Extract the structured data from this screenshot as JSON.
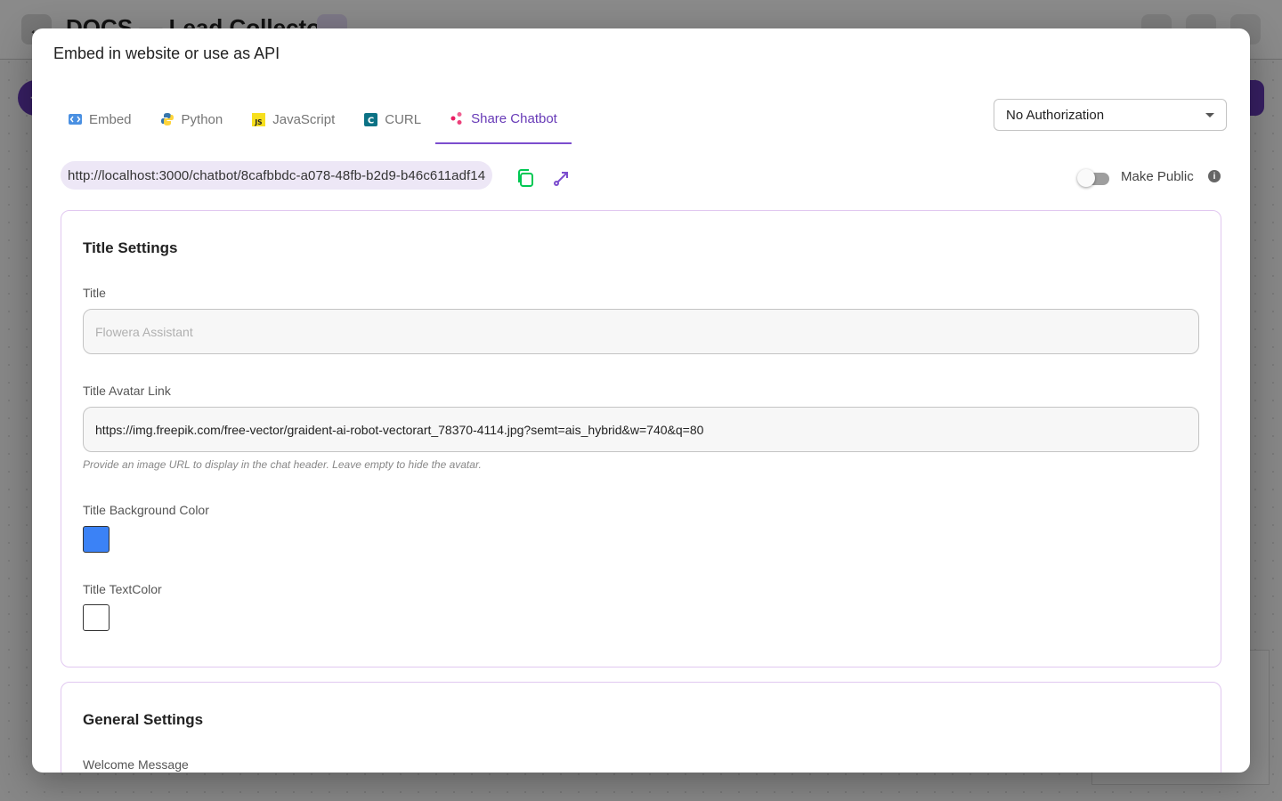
{
  "background": {
    "page_title": "DOCS — Lead Collector",
    "back_icon": "arrow-left-icon",
    "add_icon": "plus-icon"
  },
  "modal": {
    "title": "Embed in website or use as API",
    "tabs": [
      {
        "label": "Embed",
        "icon": "code-icon",
        "active": false
      },
      {
        "label": "Python",
        "icon": "python-icon",
        "active": false
      },
      {
        "label": "JavaScript",
        "icon": "javascript-icon",
        "active": false
      },
      {
        "label": "CURL",
        "icon": "curl-icon",
        "active": false
      },
      {
        "label": "Share Chatbot",
        "icon": "share-icon",
        "active": true
      }
    ],
    "authorization": {
      "selected": "No Authorization"
    },
    "share": {
      "url": "http://localhost:3000/chatbot/8cafbbdc-a078-48fb-b2d9-b46c611adf14",
      "make_public_label": "Make Public",
      "make_public_on": false
    },
    "title_settings": {
      "heading": "Title Settings",
      "title_label": "Title",
      "title_placeholder": "Flowera Assistant",
      "avatar_label": "Title Avatar Link",
      "avatar_value": "https://img.freepik.com/free-vector/graident-ai-robot-vectorart_78370-4114.jpg?semt=ais_hybrid&w=740&q=80",
      "avatar_helper": "Provide an image URL to display in the chat header. Leave empty to hide the avatar.",
      "bg_color_label": "Title Background Color",
      "bg_color": "#3b82f6",
      "text_color_label": "Title TextColor",
      "text_color": "#ffffff"
    },
    "general_settings": {
      "heading": "General Settings",
      "welcome_label": "Welcome Message"
    }
  },
  "colors": {
    "accent": "#673ab7",
    "copy_icon": "#00c853"
  }
}
